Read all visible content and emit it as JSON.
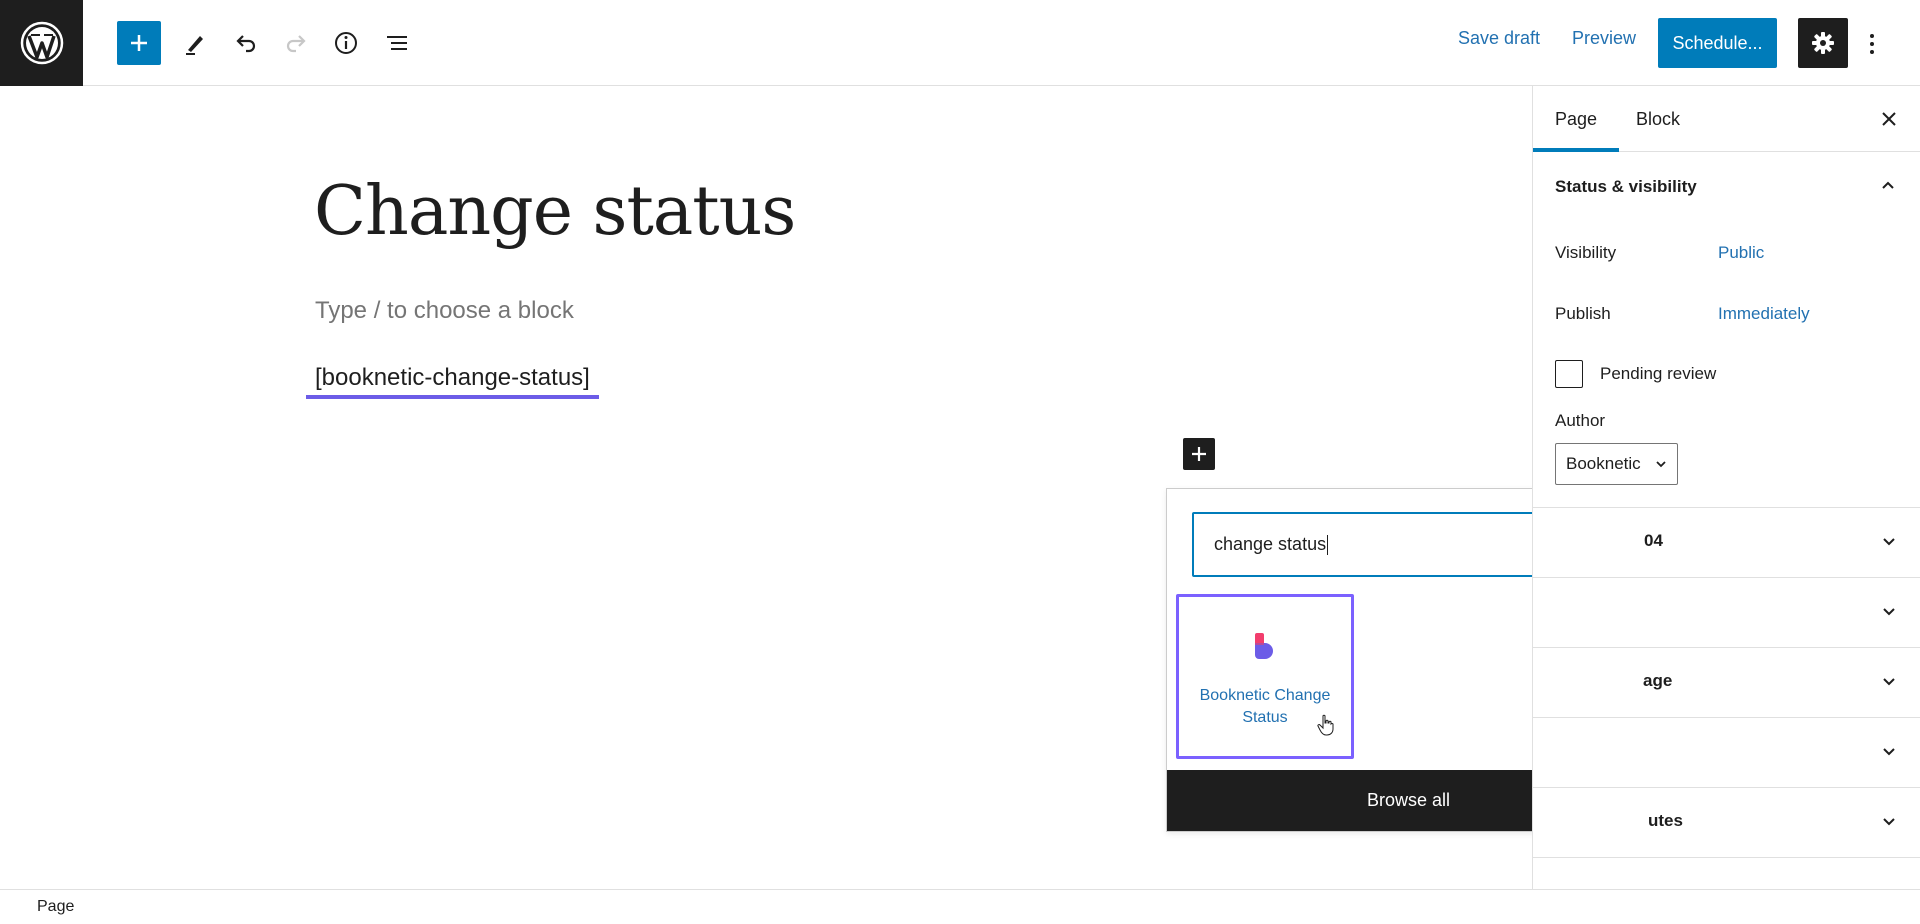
{
  "toolbar": {
    "save_draft": "Save draft",
    "preview": "Preview",
    "schedule": "Schedule..."
  },
  "editor": {
    "title": "Change status",
    "placeholder": "Type / to choose a block",
    "shortcode": "[booknetic-change-status]"
  },
  "quick_inserter": {
    "search_value": "change status",
    "result_label": "Booknetic Change Status",
    "browse_all": "Browse all"
  },
  "sidebar": {
    "tabs": [
      "Page",
      "Block"
    ],
    "status_visibility": {
      "heading": "Status & visibility",
      "visibility_label": "Visibility",
      "visibility_value": "Public",
      "publish_label": "Publish",
      "publish_value": "Immediately",
      "pending_label": "Pending review",
      "author_label": "Author",
      "author_value": "Booknetic"
    },
    "collapsed_panels": [
      "04",
      "",
      "age",
      "",
      "utes"
    ]
  },
  "footer": {
    "breadcrumb": "Page"
  },
  "colors": {
    "accent": "#007cba",
    "link": "#2271b1",
    "highlight": "#7b61ff",
    "dark": "#1e1e1e"
  }
}
